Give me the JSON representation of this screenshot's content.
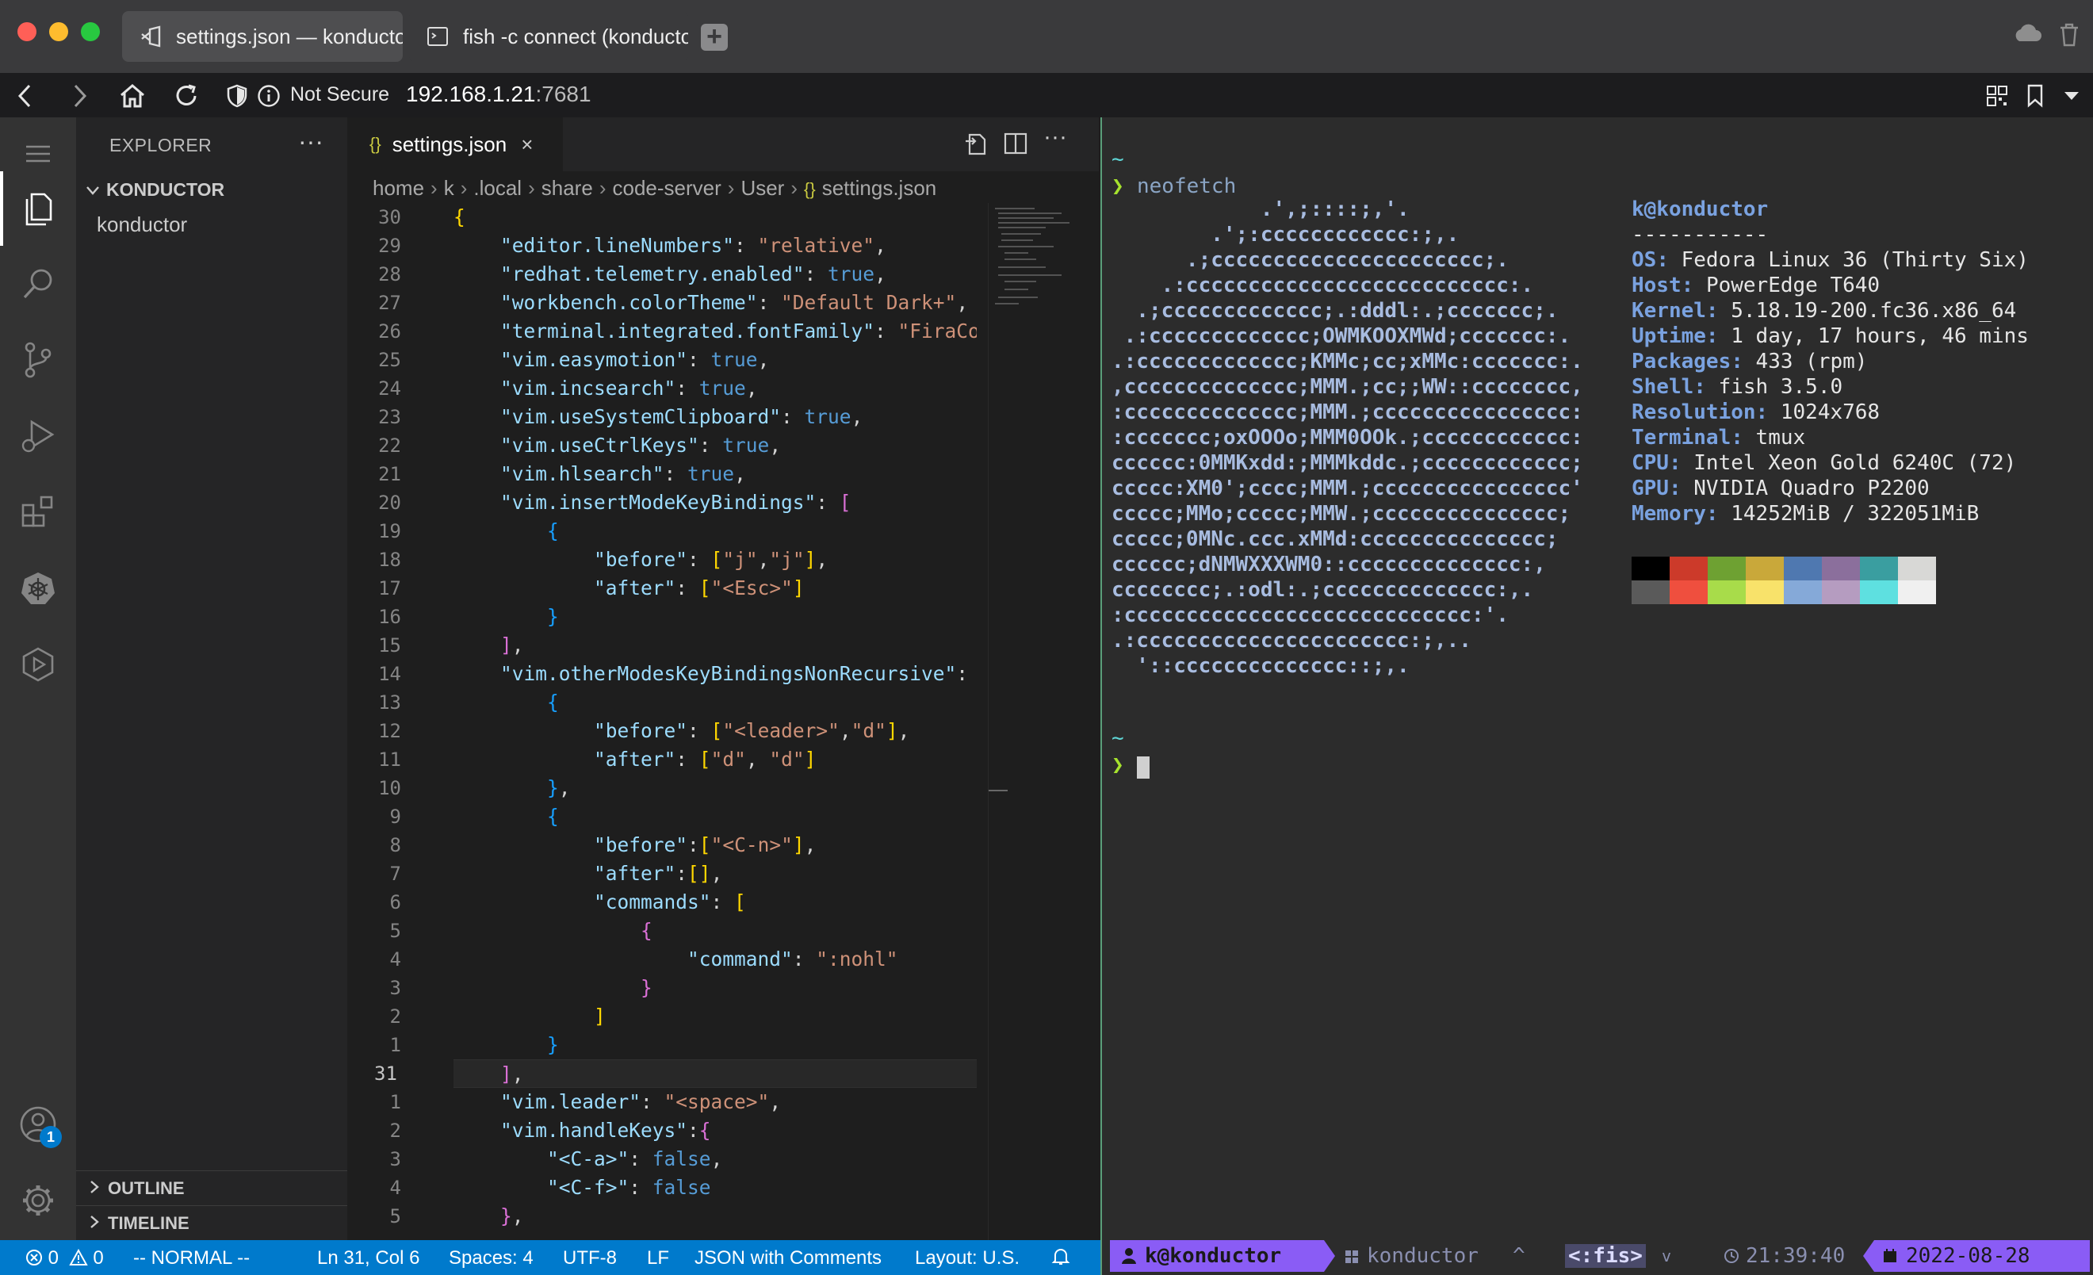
{
  "browser": {
    "tabs": [
      {
        "title": "settings.json — konductor",
        "active": true
      },
      {
        "title": "fish -c connect (konductor",
        "active": false
      }
    ],
    "security_label": "Not Secure",
    "url_host": "192.168.1.21",
    "url_port": ":7681"
  },
  "vscode": {
    "explorer": {
      "title": "EXPLORER",
      "more": "···",
      "section": "KONDUCTOR",
      "file": "konductor",
      "outline": "OUTLINE",
      "timeline": "TIMELINE"
    },
    "account_badge": "1",
    "editor_tab": {
      "braces": "{}",
      "name": "settings.json",
      "close": "×"
    },
    "breadcrumb": [
      "home",
      "k",
      ".local",
      "share",
      "code-server",
      "User"
    ],
    "breadcrumb_file": "settings.json",
    "line_numbers": [
      "30",
      "29",
      "28",
      "27",
      "26",
      "25",
      "24",
      "23",
      "22",
      "21",
      "20",
      "19",
      "18",
      "17",
      "16",
      "15",
      "14",
      "13",
      "12",
      "11",
      "10",
      "9",
      "8",
      "7",
      "6",
      "5",
      "4",
      "3",
      "2",
      "1",
      "31",
      "1",
      "2",
      "3",
      "4",
      "5"
    ],
    "current_line_index": 30,
    "statusbar": {
      "errors": "0",
      "warnings": "0",
      "mode": "-- NORMAL --",
      "position": "Ln 31, Col 6",
      "spaces": "Spaces: 4",
      "encoding": "UTF-8",
      "eol": "LF",
      "language": "JSON with Comments",
      "layout": "Layout: U.S."
    }
  },
  "code_lines": [
    [
      [
        "g1",
        "{"
      ]
    ],
    [
      [
        "p",
        "    "
      ],
      [
        "k",
        "\"editor.lineNumbers\""
      ],
      [
        "p",
        ": "
      ],
      [
        "s",
        "\"relative\""
      ],
      [
        "p",
        ","
      ]
    ],
    [
      [
        "p",
        "    "
      ],
      [
        "k",
        "\"redhat.telemetry.enabled\""
      ],
      [
        "p",
        ": "
      ],
      [
        "b",
        "true"
      ],
      [
        "p",
        ","
      ]
    ],
    [
      [
        "p",
        "    "
      ],
      [
        "k",
        "\"workbench.colorTheme\""
      ],
      [
        "p",
        ": "
      ],
      [
        "s",
        "\"Default Dark+\""
      ],
      [
        "p",
        ","
      ]
    ],
    [
      [
        "p",
        "    "
      ],
      [
        "k",
        "\"terminal.integrated.fontFamily\""
      ],
      [
        "p",
        ": "
      ],
      [
        "s",
        "\"FiraCode"
      ]
    ],
    [
      [
        "p",
        "    "
      ],
      [
        "k",
        "\"vim.easymotion\""
      ],
      [
        "p",
        ": "
      ],
      [
        "b",
        "true"
      ],
      [
        "p",
        ","
      ]
    ],
    [
      [
        "p",
        "    "
      ],
      [
        "k",
        "\"vim.incsearch\""
      ],
      [
        "p",
        ": "
      ],
      [
        "b",
        "true"
      ],
      [
        "p",
        ","
      ]
    ],
    [
      [
        "p",
        "    "
      ],
      [
        "k",
        "\"vim.useSystemClipboard\""
      ],
      [
        "p",
        ": "
      ],
      [
        "b",
        "true"
      ],
      [
        "p",
        ","
      ]
    ],
    [
      [
        "p",
        "    "
      ],
      [
        "k",
        "\"vim.useCtrlKeys\""
      ],
      [
        "p",
        ": "
      ],
      [
        "b",
        "true"
      ],
      [
        "p",
        ","
      ]
    ],
    [
      [
        "p",
        "    "
      ],
      [
        "k",
        "\"vim.hlsearch\""
      ],
      [
        "p",
        ": "
      ],
      [
        "b",
        "true"
      ],
      [
        "p",
        ","
      ]
    ],
    [
      [
        "p",
        "    "
      ],
      [
        "k",
        "\"vim.insertModeKeyBindings\""
      ],
      [
        "p",
        ": "
      ],
      [
        "g2",
        "["
      ]
    ],
    [
      [
        "p",
        "        "
      ],
      [
        "g3",
        "{"
      ]
    ],
    [
      [
        "p",
        "            "
      ],
      [
        "k",
        "\"before\""
      ],
      [
        "p",
        ": "
      ],
      [
        "g1",
        "["
      ],
      [
        "s",
        "\"j\""
      ],
      [
        "p",
        ","
      ],
      [
        "s",
        "\"j\""
      ],
      [
        "g1",
        "]"
      ],
      [
        "p",
        ","
      ]
    ],
    [
      [
        "p",
        "            "
      ],
      [
        "k",
        "\"after\""
      ],
      [
        "p",
        ": "
      ],
      [
        "g1",
        "["
      ],
      [
        "s",
        "\"<Esc>\""
      ],
      [
        "g1",
        "]"
      ]
    ],
    [
      [
        "p",
        "        "
      ],
      [
        "g3",
        "}"
      ]
    ],
    [
      [
        "p",
        "    "
      ],
      [
        "g2",
        "]"
      ],
      [
        "p",
        ","
      ]
    ],
    [
      [
        "p",
        "    "
      ],
      [
        "k",
        "\"vim.otherModesKeyBindingsNonRecursive\""
      ],
      [
        "p",
        ": "
      ],
      [
        "g2",
        "["
      ]
    ],
    [
      [
        "p",
        "        "
      ],
      [
        "g3",
        "{"
      ]
    ],
    [
      [
        "p",
        "            "
      ],
      [
        "k",
        "\"before\""
      ],
      [
        "p",
        ": "
      ],
      [
        "g1",
        "["
      ],
      [
        "s",
        "\"<leader>\""
      ],
      [
        "p",
        ","
      ],
      [
        "s",
        "\"d\""
      ],
      [
        "g1",
        "]"
      ],
      [
        "p",
        ","
      ]
    ],
    [
      [
        "p",
        "            "
      ],
      [
        "k",
        "\"after\""
      ],
      [
        "p",
        ": "
      ],
      [
        "g1",
        "["
      ],
      [
        "s",
        "\"d\""
      ],
      [
        "p",
        ", "
      ],
      [
        "s",
        "\"d\""
      ],
      [
        "g1",
        "]"
      ]
    ],
    [
      [
        "p",
        "        "
      ],
      [
        "g3",
        "}"
      ],
      [
        "p",
        ","
      ]
    ],
    [
      [
        "p",
        "        "
      ],
      [
        "g3",
        "{"
      ]
    ],
    [
      [
        "p",
        "            "
      ],
      [
        "k",
        "\"before\""
      ],
      [
        "p",
        ":"
      ],
      [
        "g1",
        "["
      ],
      [
        "s",
        "\"<C-n>\""
      ],
      [
        "g1",
        "]"
      ],
      [
        "p",
        ","
      ]
    ],
    [
      [
        "p",
        "            "
      ],
      [
        "k",
        "\"after\""
      ],
      [
        "p",
        ":"
      ],
      [
        "g1",
        "[]"
      ],
      [
        "p",
        ","
      ]
    ],
    [
      [
        "p",
        "            "
      ],
      [
        "k",
        "\"commands\""
      ],
      [
        "p",
        ": "
      ],
      [
        "g1",
        "["
      ]
    ],
    [
      [
        "p",
        "                "
      ],
      [
        "g2",
        "{"
      ]
    ],
    [
      [
        "p",
        "                    "
      ],
      [
        "k",
        "\"command\""
      ],
      [
        "p",
        ": "
      ],
      [
        "s",
        "\":nohl\""
      ]
    ],
    [
      [
        "p",
        "                "
      ],
      [
        "g2",
        "}"
      ]
    ],
    [
      [
        "p",
        "            "
      ],
      [
        "g1",
        "]"
      ]
    ],
    [
      [
        "p",
        "        "
      ],
      [
        "g3",
        "}"
      ]
    ],
    [
      [
        "p",
        "    "
      ],
      [
        "g2",
        "]"
      ],
      [
        "p",
        ","
      ]
    ],
    [
      [
        "p",
        "    "
      ],
      [
        "k",
        "\"vim.leader\""
      ],
      [
        "p",
        ": "
      ],
      [
        "s",
        "\"<space>\""
      ],
      [
        "p",
        ","
      ]
    ],
    [
      [
        "p",
        "    "
      ],
      [
        "k",
        "\"vim.handleKeys\""
      ],
      [
        "p",
        ":"
      ],
      [
        "g2",
        "{"
      ]
    ],
    [
      [
        "p",
        "        "
      ],
      [
        "k",
        "\"<C-a>\""
      ],
      [
        "p",
        ": "
      ],
      [
        "b",
        "false"
      ],
      [
        "p",
        ","
      ]
    ],
    [
      [
        "p",
        "        "
      ],
      [
        "k",
        "\"<C-f>\""
      ],
      [
        "p",
        ": "
      ],
      [
        "b",
        "false"
      ]
    ],
    [
      [
        "p",
        "    "
      ],
      [
        "g2",
        "}"
      ],
      [
        "p",
        ","
      ]
    ]
  ],
  "terminal": {
    "tilde": "~",
    "prompt_symbol": "❯",
    "command": "neofetch",
    "ascii_art": [
      "            .',;::::;,'.",
      "        .';:cccccccccccc:;,.",
      "      .;cccccccccccccccccccccc;.",
      "    .:cccccccccccccccccccccccccc:.",
      "  .;ccccccccccccc;.:dddl:.;ccccccc;.",
      " .:ccccccccccccc;OWMKOOXMWd;ccccccc:.",
      ".:ccccccccccccc;KMMc;cc;xMMc:ccccccc:.",
      ",cccccccccccccc;MMM.;cc;;WW::cccccccc,",
      ":cccccccccccccc;MMM.;cccccccccccccccc:",
      ":ccccccc;oxOOOo;MMM0OOk.;cccccccccccc:",
      "cccccc:0MMKxdd:;MMMkddc.;cccccccccccc;",
      "ccccc:XM0';cccc;MMM.;cccccccccccccccc'",
      "ccccc;MMo;ccccc;MMW.;ccccccccccccccc;",
      "ccccc;0MNc.ccc.xMMd:ccccccccccccccc;",
      "cccccc;dNMWXXXWM0::cccccccccccccc:,",
      "cccccccc;.:odl:.;cccccccccccccc:,.",
      ":cccccccccccccccccccccccccccc:'.",
      ".:cccccccccccccccccccccc:;,..",
      "  '::cccccccccccccc::;,."
    ],
    "user_host": "k@konductor",
    "separator": "-----------",
    "info": [
      {
        "label": "OS",
        "value": "Fedora Linux 36 (Thirty Six)"
      },
      {
        "label": "Host",
        "value": "PowerEdge T640"
      },
      {
        "label": "Kernel",
        "value": "5.18.19-200.fc36.x86_64"
      },
      {
        "label": "Uptime",
        "value": "1 day, 17 hours, 46 mins"
      },
      {
        "label": "Packages",
        "value": "433 (rpm)"
      },
      {
        "label": "Shell",
        "value": "fish 3.5.0"
      },
      {
        "label": "Resolution",
        "value": "1024x768"
      },
      {
        "label": "Terminal",
        "value": "tmux"
      },
      {
        "label": "CPU",
        "value": "Intel Xeon Gold 6240C (72)"
      },
      {
        "label": "GPU",
        "value": "NVIDIA Quadro P2200"
      },
      {
        "label": "Memory",
        "value": "14252MiB / 322051MiB"
      }
    ],
    "palette_top": [
      "#000000",
      "#cc3a2a",
      "#6ea132",
      "#c9a83a",
      "#4f78b0",
      "#8b6f9c",
      "#3a9ea0",
      "#d8d8d6"
    ],
    "palette_bottom": [
      "#5a5a5a",
      "#ef4f3e",
      "#a8dc4a",
      "#f8e26a",
      "#85a9d8",
      "#b59cc0",
      "#5ee0e0",
      "#f0f0f0"
    ],
    "tmux": {
      "user_host": "k@konductor",
      "session": "konductor",
      "up_arrow": "^",
      "window": "<:fis>",
      "down_arrow": "v",
      "time": "21:39:40",
      "date": "2022-08-28"
    }
  }
}
